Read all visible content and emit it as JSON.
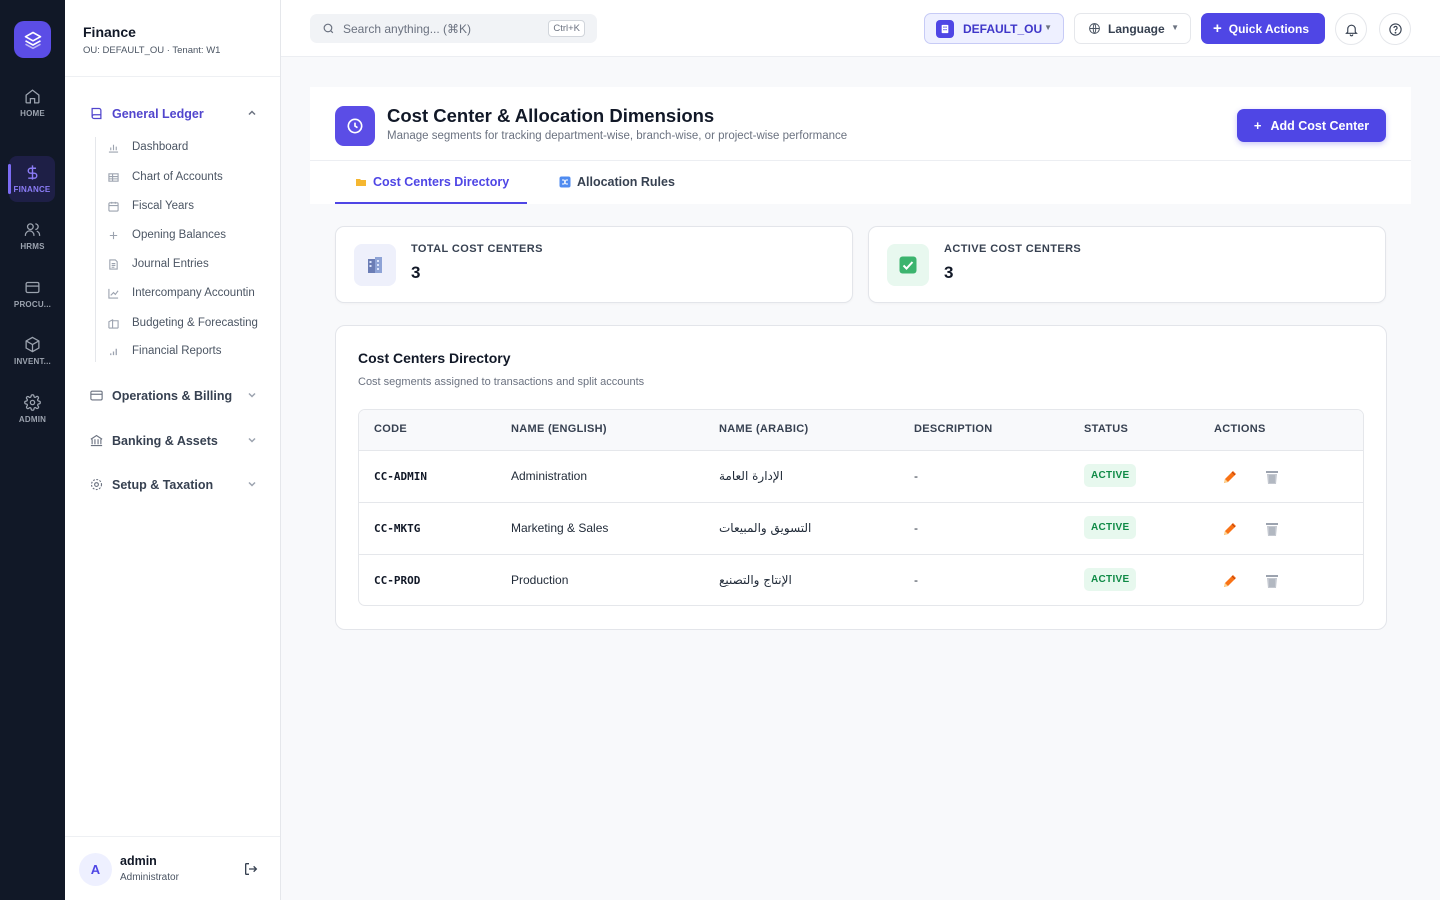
{
  "rail": {
    "items": [
      {
        "label": "HOME",
        "icon": "home-icon"
      },
      {
        "label": "FINANCE",
        "icon": "dollar-icon"
      },
      {
        "label": "HRMS",
        "icon": "users-icon"
      },
      {
        "label": "PROCU...",
        "icon": "card-icon"
      },
      {
        "label": "INVENT...",
        "icon": "box-icon"
      },
      {
        "label": "ADMIN",
        "icon": "gear-icon"
      }
    ],
    "active": "FINANCE"
  },
  "sidebar": {
    "title": "Finance",
    "subtitle": "OU: DEFAULT_OU · Tenant: W1",
    "groups": [
      {
        "label": "General Ledger",
        "expanded": true
      },
      {
        "label": "Operations & Billing"
      },
      {
        "label": "Banking & Assets"
      },
      {
        "label": "Setup & Taxation"
      }
    ],
    "ledger_items": [
      "Dashboard",
      "Chart of Accounts",
      "Fiscal Years",
      "Opening Balances",
      "Journal Entries",
      "Intercompany Accountin",
      "Budgeting & Forecasting",
      "Financial Reports"
    ],
    "user": {
      "initial": "A",
      "name": "admin",
      "role": "Administrator"
    }
  },
  "topbar": {
    "search_placeholder": "Search anything... (⌘K)",
    "search_shortcut": "Ctrl+K",
    "ou_label": "DEFAULT_OU",
    "language_label": "Language",
    "quick_actions_label": "Quick Actions"
  },
  "page": {
    "title": "Cost Center & Allocation Dimensions",
    "subtitle": "Manage segments for tracking department-wise, branch-wise, or project-wise performance",
    "add_button": "Add Cost Center",
    "tabs": [
      {
        "label": "Cost Centers Directory",
        "active": true
      },
      {
        "label": "Allocation Rules",
        "active": false
      }
    ]
  },
  "stats": [
    {
      "label": "TOTAL COST CENTERS",
      "value": "3"
    },
    {
      "label": "ACTIVE COST CENTERS",
      "value": "3"
    }
  ],
  "directory": {
    "title": "Cost Centers Directory",
    "subtitle": "Cost segments assigned to transactions and split accounts",
    "columns": [
      "CODE",
      "NAME (ENGLISH)",
      "NAME (ARABIC)",
      "DESCRIPTION",
      "STATUS",
      "ACTIONS"
    ],
    "rows": [
      {
        "code": "CC-ADMIN",
        "name_en": "Administration",
        "name_ar": "الإدارة العامة",
        "description": "-",
        "status": "ACTIVE"
      },
      {
        "code": "CC-MKTG",
        "name_en": "Marketing & Sales",
        "name_ar": "التسويق والمبيعات",
        "description": "-",
        "status": "ACTIVE"
      },
      {
        "code": "CC-PROD",
        "name_en": "Production",
        "name_ar": "الإنتاج والتصنيع",
        "description": "-",
        "status": "ACTIVE"
      }
    ]
  },
  "colors": {
    "primary": "#4f46e5",
    "rail_bg": "#111827",
    "active_green": "#0f8a46",
    "edit_orange": "#f97316"
  }
}
